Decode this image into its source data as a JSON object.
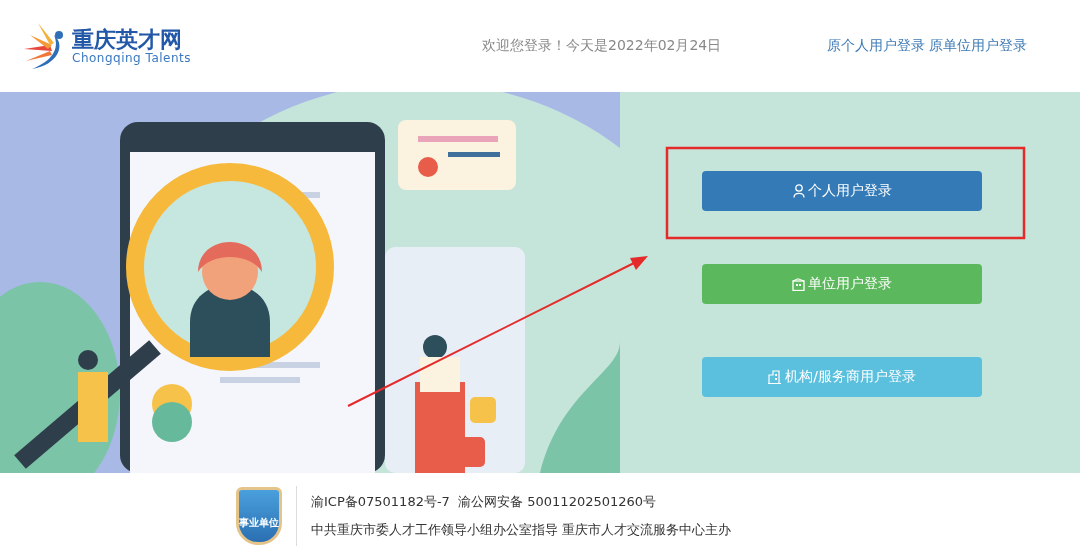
{
  "header": {
    "logo_title": "重庆英才网",
    "logo_subtitle": "Chongqing Talents",
    "welcome": "欢迎您登录！今天是2022年02月24日",
    "links": [
      {
        "label": "原个人用户登录"
      },
      {
        "label": "原单位用户登录"
      }
    ]
  },
  "login_buttons": [
    {
      "kind": "person",
      "label": "个人用户登录"
    },
    {
      "kind": "company",
      "label": "单位用户登录"
    },
    {
      "kind": "institution",
      "label": "机构/服务商用户登录"
    }
  ],
  "footer": {
    "badge": "事业单位",
    "line_1": "渝ICP备07501182号-7  渝公网安备 50011202501260号",
    "line_2": "中共重庆市委人才工作领导小组办公室指导 重庆市人才交流服务中心主办"
  }
}
